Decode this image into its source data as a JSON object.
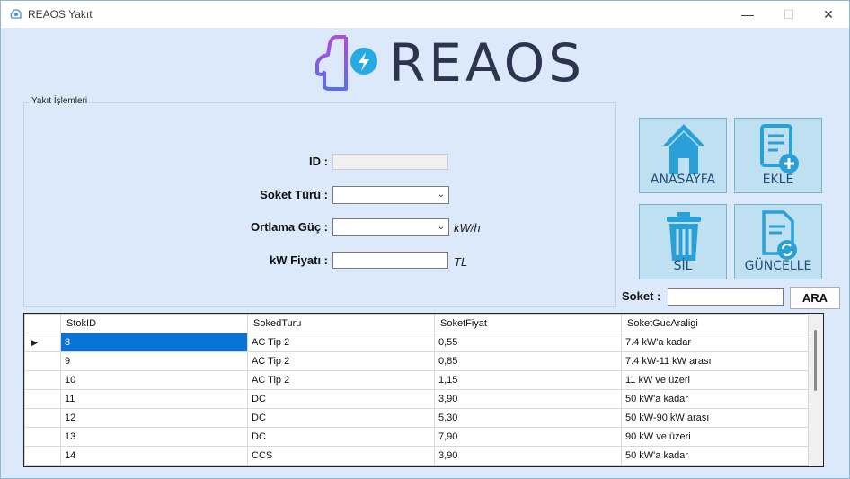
{
  "window": {
    "title": "REAOS Yakıt",
    "controls": {
      "minimize": "—",
      "maximize": "☐",
      "close": "✕"
    }
  },
  "logo": {
    "text": "REAOS"
  },
  "form": {
    "group_title": "Yakıt İşlemleri",
    "id_label": "ID :",
    "id_value": "",
    "soket_turu_label": "Soket Türü :",
    "soket_turu_value": "",
    "ortalama_guc_label": "Ortlama Güç :",
    "ortalama_guc_value": "",
    "ortalama_guc_unit": "kW/h",
    "kw_fiyati_label": "kW Fiyatı :",
    "kw_fiyati_value": "",
    "kw_fiyati_unit": "TL"
  },
  "tiles": {
    "anasayfa": "ANASAYFA",
    "ekle": "EKLE",
    "sil": "SİL",
    "guncelle": "GÜNCELLE"
  },
  "search": {
    "label": "Soket :",
    "value": "",
    "button": "ARA"
  },
  "grid": {
    "columns": [
      "StokID",
      "SokedTuru",
      "SoketFiyat",
      "SoketGucAraligi"
    ],
    "rows": [
      [
        "8",
        "AC Tip 2",
        "0,55",
        "7.4 kW'a kadar"
      ],
      [
        "9",
        "AC Tip 2",
        "0,85",
        "7.4 kW-11 kW arası"
      ],
      [
        "10",
        "AC Tip 2",
        "1,15",
        "11 kW ve üzeri"
      ],
      [
        "11",
        "DC",
        "3,90",
        "50 kW'a kadar"
      ],
      [
        "12",
        "DC",
        "5,30",
        "50 kW-90 kW arası"
      ],
      [
        "13",
        "DC",
        "7,90",
        "90 kW ve üzeri"
      ],
      [
        "14",
        "CCS",
        "3,90",
        "50 kW'a kadar"
      ]
    ],
    "selected_row": 0
  },
  "colors": {
    "background": "#dbe9fb",
    "tile_background": "#bfe0f0",
    "tile_text": "#1f4e79",
    "selection": "#0a74d6",
    "logo_text": "#2c3450"
  }
}
